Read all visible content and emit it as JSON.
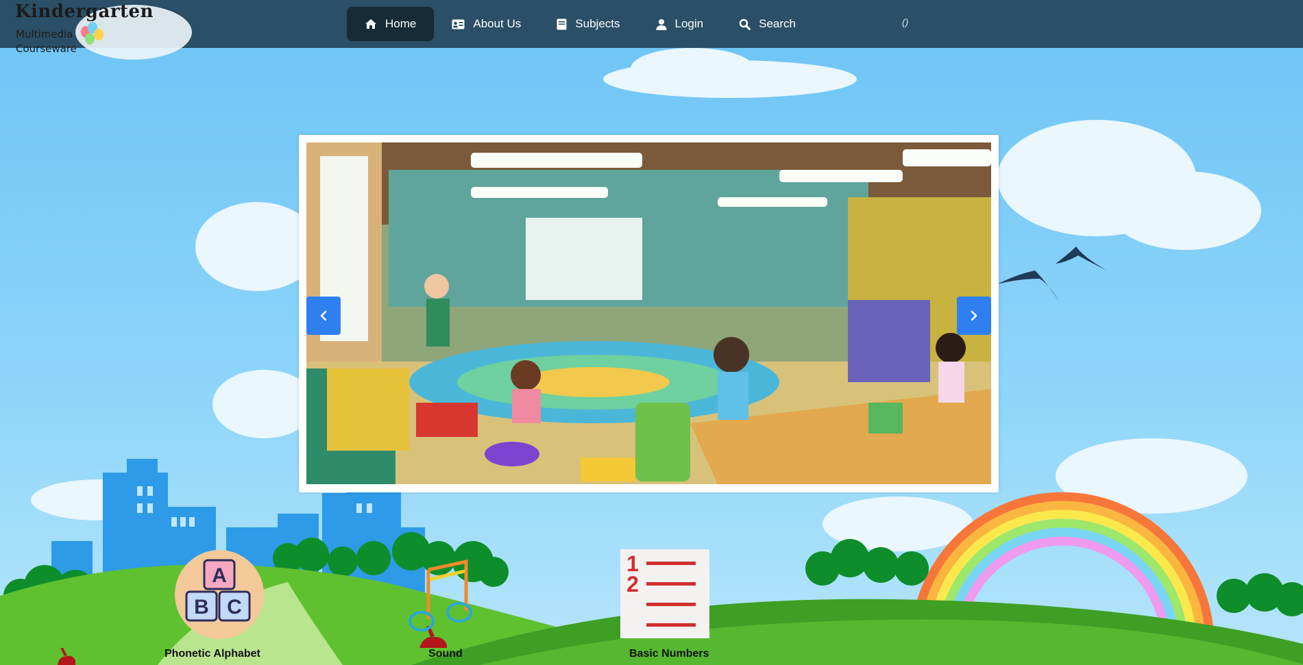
{
  "logo": {
    "title": "Kindergarten",
    "subtitle_line1": "Multimedia",
    "subtitle_line2": "Courseware"
  },
  "nav": {
    "items": [
      {
        "label": "Home",
        "icon": "home-icon",
        "active": true
      },
      {
        "label": "About Us",
        "icon": "id-card-icon",
        "active": false
      },
      {
        "label": "Subjects",
        "icon": "book-icon",
        "active": false
      },
      {
        "label": "Login",
        "icon": "user-icon",
        "active": false
      },
      {
        "label": "Search",
        "icon": "search-icon",
        "active": false
      }
    ],
    "extra_text": "()"
  },
  "carousel": {
    "image_subject": "kindergarten-classroom-illustration",
    "prev_icon": "chevron-left-icon",
    "next_icon": "chevron-right-icon"
  },
  "subjects": [
    {
      "label": "Phonetic Alphabet",
      "icon": "abc-blocks-icon"
    },
    {
      "label": "Sound",
      "icon": "music-note-icon"
    },
    {
      "label": "Basic Numbers",
      "icon": "numbered-list-icon"
    }
  ],
  "colors": {
    "header_bg": "#2a4f66",
    "nav_active_bg": "#162a37",
    "arrow_bg": "#2f7ff0",
    "sky": "#7cccf7",
    "grass": "#4cb830"
  }
}
